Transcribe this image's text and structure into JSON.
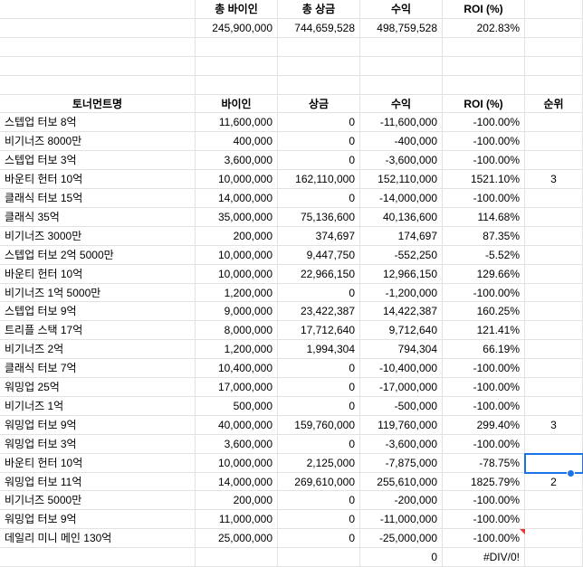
{
  "summary": {
    "headers": [
      "총 바이인",
      "총 상금",
      "수익",
      "ROI (%)"
    ],
    "values": [
      "245,900,000",
      "744,659,528",
      "498,759,528",
      "202.83%"
    ]
  },
  "table": {
    "headers": [
      "토너먼트명",
      "바이인",
      "상금",
      "수익",
      "ROI (%)",
      "순위"
    ],
    "rows": [
      [
        "스텝업 터보 8억",
        "11,600,000",
        "0",
        "-11,600,000",
        "-100.00%",
        ""
      ],
      [
        "비기너즈 8000만",
        "400,000",
        "0",
        "-400,000",
        "-100.00%",
        ""
      ],
      [
        "스텝업 터보 3억",
        "3,600,000",
        "0",
        "-3,600,000",
        "-100.00%",
        ""
      ],
      [
        "바운티 헌터 10억",
        "10,000,000",
        "162,110,000",
        "152,110,000",
        "1521.10%",
        "3"
      ],
      [
        "클래식 터보 15억",
        "14,000,000",
        "0",
        "-14,000,000",
        "-100.00%",
        ""
      ],
      [
        "클래식 35억",
        "35,000,000",
        "75,136,600",
        "40,136,600",
        "114.68%",
        ""
      ],
      [
        "비기너즈 3000만",
        "200,000",
        "374,697",
        "174,697",
        "87.35%",
        ""
      ],
      [
        "스텝업 터보 2억 5000만",
        "10,000,000",
        "9,447,750",
        "-552,250",
        "-5.52%",
        ""
      ],
      [
        "바운티 헌터 10억",
        "10,000,000",
        "22,966,150",
        "12,966,150",
        "129.66%",
        ""
      ],
      [
        "비기너즈 1억 5000만",
        "1,200,000",
        "0",
        "-1,200,000",
        "-100.00%",
        ""
      ],
      [
        "스텝업 터보 9억",
        "9,000,000",
        "23,422,387",
        "14,422,387",
        "160.25%",
        ""
      ],
      [
        "트리플 스택 17억",
        "8,000,000",
        "17,712,640",
        "9,712,640",
        "121.41%",
        ""
      ],
      [
        "비기너즈 2억",
        "1,200,000",
        "1,994,304",
        "794,304",
        "66.19%",
        ""
      ],
      [
        "클래식 터보 7억",
        "10,400,000",
        "0",
        "-10,400,000",
        "-100.00%",
        ""
      ],
      [
        "워밍업 25억",
        "17,000,000",
        "0",
        "-17,000,000",
        "-100.00%",
        ""
      ],
      [
        "비기너즈 1억",
        "500,000",
        "0",
        "-500,000",
        "-100.00%",
        ""
      ],
      [
        "워밍업 터보 9억",
        "40,000,000",
        "159,760,000",
        "119,760,000",
        "299.40%",
        "3"
      ],
      [
        "워밍업 터보 3억",
        "3,600,000",
        "0",
        "-3,600,000",
        "-100.00%",
        ""
      ],
      [
        "바운티 헌터 10억",
        "10,000,000",
        "2,125,000",
        "-7,875,000",
        "-78.75%",
        ""
      ],
      [
        "워밍업 터보 11억",
        "14,000,000",
        "269,610,000",
        "255,610,000",
        "1825.79%",
        "2"
      ],
      [
        "비기너즈 5000만",
        "200,000",
        "0",
        "-200,000",
        "-100.00%",
        ""
      ],
      [
        "워밍업 터보 9억",
        "11,000,000",
        "0",
        "-11,000,000",
        "-100.00%",
        ""
      ],
      [
        "데일리 미니 메인 130억",
        "25,000,000",
        "0",
        "-25,000,000",
        "-100.00%",
        ""
      ]
    ],
    "last_row": [
      "",
      "",
      "",
      "0",
      "#DIV/0!",
      ""
    ]
  },
  "colors": {
    "gridline": "#e2e2e2",
    "selection": "#1a73e8",
    "comment_marker": "#e53935"
  }
}
